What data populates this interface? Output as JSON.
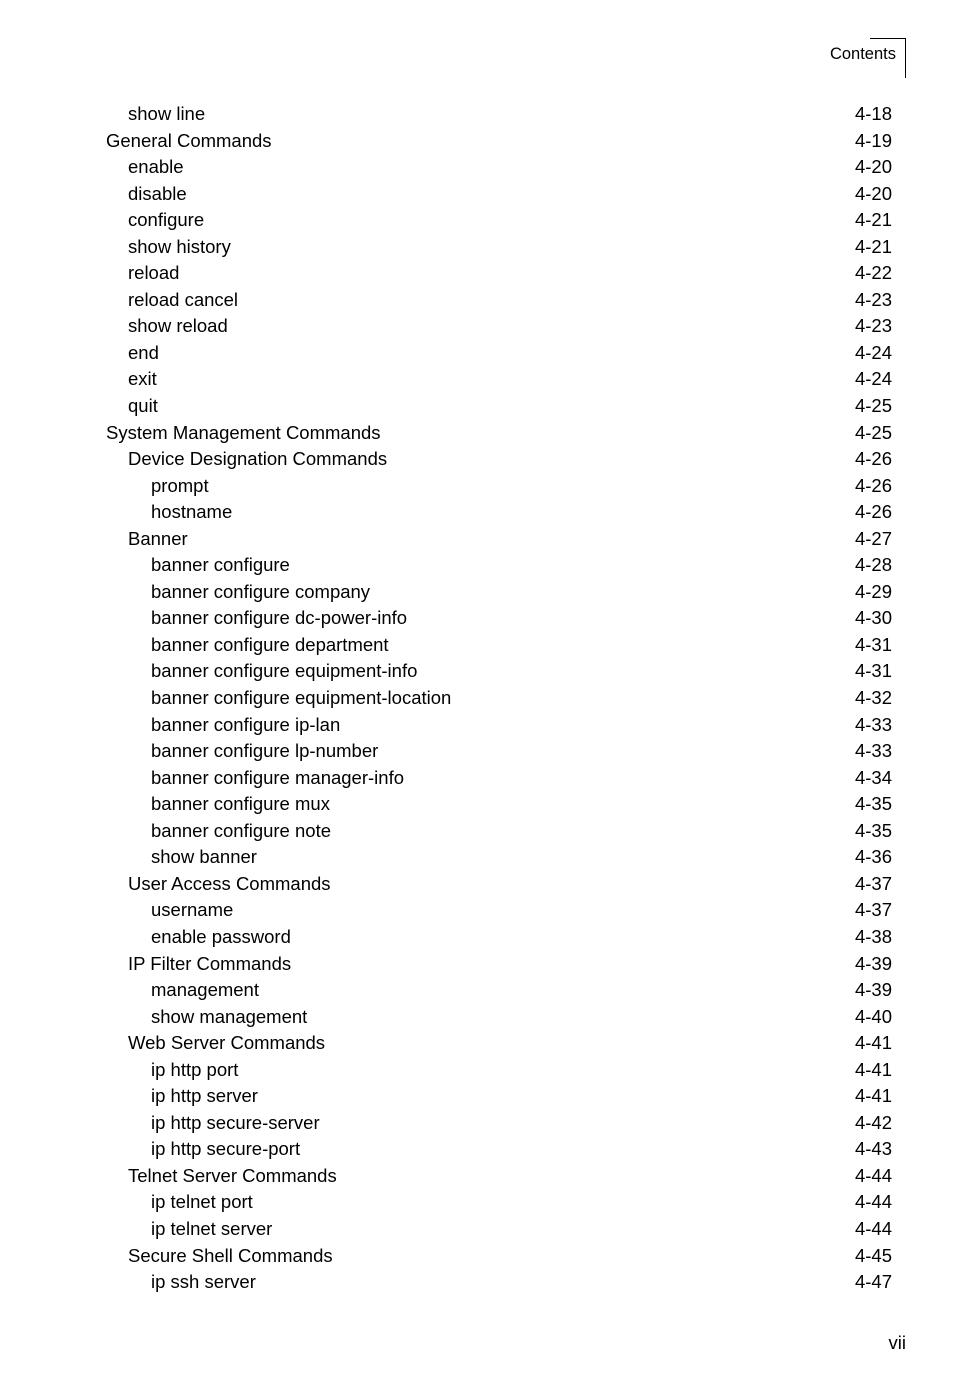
{
  "header": {
    "label": "Contents"
  },
  "footer": {
    "page_number": "vii"
  },
  "toc": {
    "entries": [
      {
        "title": "show line",
        "page": "4-18",
        "level": 1
      },
      {
        "title": "General Commands",
        "page": "4-19",
        "level": 0
      },
      {
        "title": "enable",
        "page": "4-20",
        "level": 1
      },
      {
        "title": "disable",
        "page": "4-20",
        "level": 1
      },
      {
        "title": "configure",
        "page": "4-21",
        "level": 1
      },
      {
        "title": "show history",
        "page": "4-21",
        "level": 1
      },
      {
        "title": "reload",
        "page": "4-22",
        "level": 1
      },
      {
        "title": "reload cancel",
        "page": "4-23",
        "level": 1
      },
      {
        "title": "show reload",
        "page": "4-23",
        "level": 1
      },
      {
        "title": "end",
        "page": "4-24",
        "level": 1
      },
      {
        "title": "exit",
        "page": "4-24",
        "level": 1
      },
      {
        "title": "quit",
        "page": "4-25",
        "level": 1
      },
      {
        "title": "System Management Commands",
        "page": "4-25",
        "level": 0
      },
      {
        "title": "Device Designation Commands",
        "page": "4-26",
        "level": 1
      },
      {
        "title": "prompt",
        "page": "4-26",
        "level": 2
      },
      {
        "title": "hostname",
        "page": "4-26",
        "level": 2
      },
      {
        "title": "Banner",
        "page": "4-27",
        "level": 1
      },
      {
        "title": "banner configure",
        "page": "4-28",
        "level": 2
      },
      {
        "title": "banner configure company",
        "page": "4-29",
        "level": 2
      },
      {
        "title": "banner configure dc-power-info",
        "page": "4-30",
        "level": 2
      },
      {
        "title": "banner configure department",
        "page": "4-31",
        "level": 2
      },
      {
        "title": "banner configure equipment-info",
        "page": "4-31",
        "level": 2
      },
      {
        "title": "banner configure equipment-location",
        "page": "4-32",
        "level": 2
      },
      {
        "title": "banner configure ip-lan",
        "page": "4-33",
        "level": 2
      },
      {
        "title": "banner configure lp-number",
        "page": "4-33",
        "level": 2
      },
      {
        "title": "banner configure manager-info",
        "page": "4-34",
        "level": 2
      },
      {
        "title": "banner configure mux",
        "page": "4-35",
        "level": 2
      },
      {
        "title": "banner configure note",
        "page": "4-35",
        "level": 2
      },
      {
        "title": "show banner",
        "page": "4-36",
        "level": 2
      },
      {
        "title": "User Access Commands",
        "page": "4-37",
        "level": 1
      },
      {
        "title": "username",
        "page": "4-37",
        "level": 2
      },
      {
        "title": "enable password",
        "page": "4-38",
        "level": 2
      },
      {
        "title": "IP Filter Commands",
        "page": "4-39",
        "level": 1
      },
      {
        "title": "management",
        "page": "4-39",
        "level": 2
      },
      {
        "title": "show management",
        "page": "4-40",
        "level": 2
      },
      {
        "title": "Web Server Commands",
        "page": "4-41",
        "level": 1
      },
      {
        "title": "ip http port",
        "page": "4-41",
        "level": 2
      },
      {
        "title": "ip http server",
        "page": "4-41",
        "level": 2
      },
      {
        "title": "ip http secure-server",
        "page": "4-42",
        "level": 2
      },
      {
        "title": "ip http secure-port",
        "page": "4-43",
        "level": 2
      },
      {
        "title": "Telnet Server Commands",
        "page": "4-44",
        "level": 1
      },
      {
        "title": "ip telnet port",
        "page": "4-44",
        "level": 2
      },
      {
        "title": "ip telnet server",
        "page": "4-44",
        "level": 2
      },
      {
        "title": "Secure Shell Commands",
        "page": "4-45",
        "level": 1
      },
      {
        "title": "ip ssh server",
        "page": "4-47",
        "level": 2
      }
    ]
  }
}
